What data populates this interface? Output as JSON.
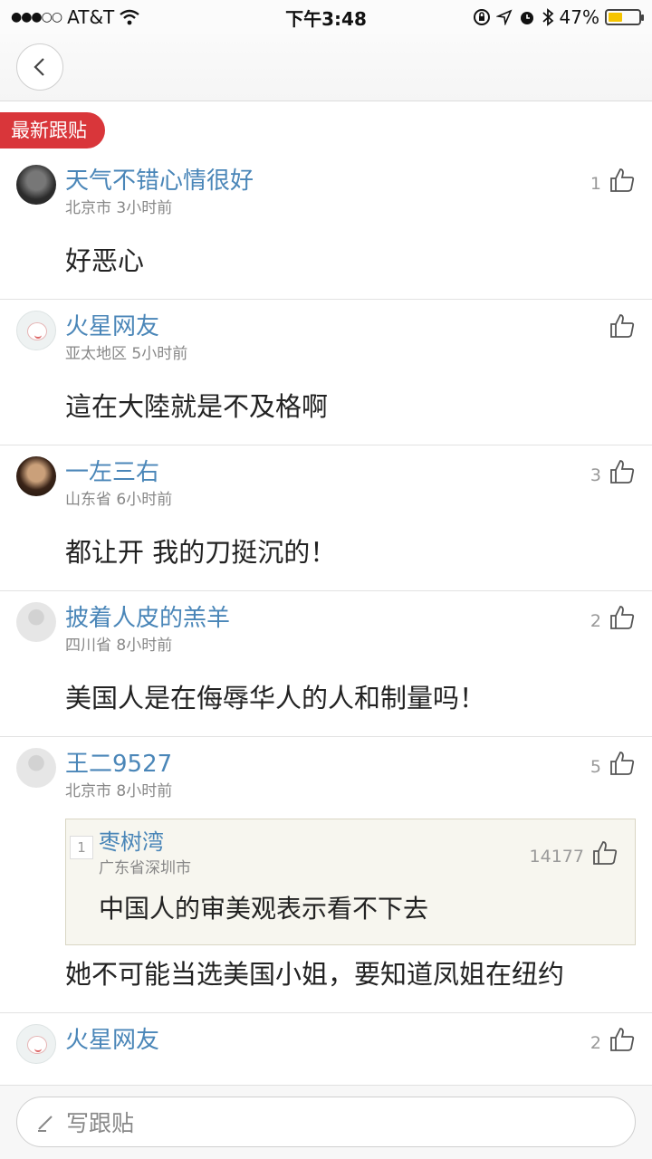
{
  "status_bar": {
    "signal": "●●●○○",
    "carrier": "AT&T",
    "time": "下午3:48",
    "battery": "47%",
    "battery_level": 0.47
  },
  "section_label": "最新跟贴",
  "comments": [
    {
      "name": "天气不错心情很好",
      "location": "北京市 3小时前",
      "likes": "1",
      "text": "好恶心"
    },
    {
      "name": "火星网友",
      "location": "亚太地区 5小时前",
      "likes": "",
      "text": "這在大陸就是不及格啊"
    },
    {
      "name": "一左三右",
      "location": "山东省 6小时前",
      "likes": "3",
      "text": "都让开 我的刀挺沉的！"
    },
    {
      "name": "披着人皮的羔羊",
      "location": "四川省 8小时前",
      "likes": "2",
      "text": "美国人是在侮辱华人的人和制量吗！"
    },
    {
      "name": "王二9527",
      "location": "北京市 8小时前",
      "likes": "5",
      "quote": {
        "index": "1",
        "name": "枣树湾",
        "location": "广东省深圳市",
        "likes": "14177",
        "text": "中国人的审美观表示看不下去"
      },
      "text": "她不可能当选美国小姐，要知道凤姐在纽约"
    },
    {
      "name": "火星网友",
      "location": "",
      "likes": "2",
      "text": ""
    }
  ],
  "reply_placeholder": "写跟贴"
}
